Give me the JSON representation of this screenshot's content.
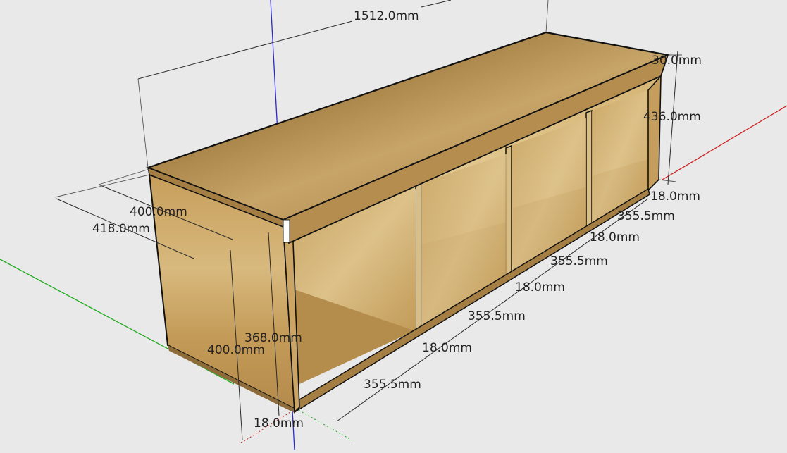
{
  "dimensions": {
    "overall_length": "1512.0mm",
    "top_thickness": "30.0mm",
    "height_right": "436.0mm",
    "side_bottom_right": "18.0mm",
    "cell_1": "355.5mm",
    "divider_1": "18.0mm",
    "cell_2": "355.5mm",
    "divider_2": "18.0mm",
    "cell_3": "355.5mm",
    "divider_3": "18.0mm",
    "cell_4": "355.5mm",
    "inner_depth": "400.0mm",
    "outer_depth": "418.0mm",
    "inner_height": "368.0mm",
    "side_height": "400.0mm",
    "bottom_thickness": "18.0mm"
  },
  "colors": {
    "background": "#e9e9e9",
    "axis_red": "#cc2222",
    "axis_green": "#1faa1f",
    "axis_blue": "#2a2ad0",
    "wood_top": "#b9904f",
    "wood_side": "#c29a5a",
    "wood_inner": "#d2b070",
    "wood_shadow": "#9b7640"
  }
}
